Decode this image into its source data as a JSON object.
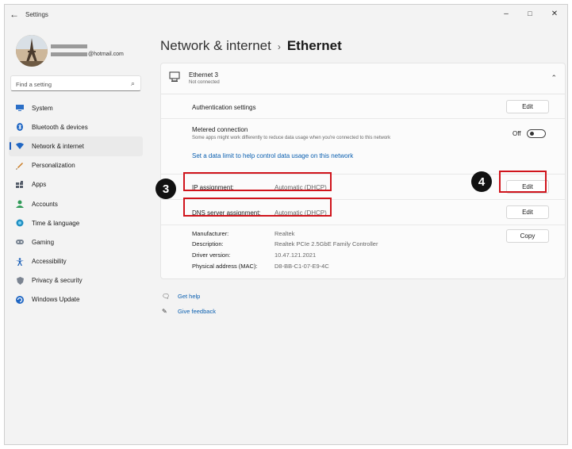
{
  "app": {
    "title": "Settings",
    "window_min": "–",
    "window_max": "□",
    "window_close": "✕"
  },
  "account": {
    "email_suffix": "@hotmail.com"
  },
  "search": {
    "placeholder": "Find a setting"
  },
  "sidebar": {
    "items": [
      {
        "label": "System",
        "icon": "monitor-icon",
        "color": "#2b6fc7"
      },
      {
        "label": "Bluetooth & devices",
        "icon": "bluetooth-icon",
        "color": "#1f66c3"
      },
      {
        "label": "Network & internet",
        "icon": "wifi-icon",
        "color": "#1f66c3",
        "active": true
      },
      {
        "label": "Personalization",
        "icon": "brush-icon",
        "color": "#c9791f"
      },
      {
        "label": "Apps",
        "icon": "apps-icon",
        "color": "#555d6a"
      },
      {
        "label": "Accounts",
        "icon": "person-icon",
        "color": "#2f9a57"
      },
      {
        "label": "Time & language",
        "icon": "globe-clock-icon",
        "color": "#1f8fc2"
      },
      {
        "label": "Gaming",
        "icon": "gamepad-icon",
        "color": "#7a8592"
      },
      {
        "label": "Accessibility",
        "icon": "accessibility-icon",
        "color": "#1a5fb8"
      },
      {
        "label": "Privacy & security",
        "icon": "shield-icon",
        "color": "#7b8491"
      },
      {
        "label": "Windows Update",
        "icon": "refresh-icon",
        "color": "#1f66c3"
      }
    ]
  },
  "header": {
    "breadcrumb_parent": "Network & internet",
    "separator": "›",
    "breadcrumb_current": "Ethernet"
  },
  "adapter": {
    "name": "Ethernet 3",
    "status": "Not connected",
    "auth": {
      "label": "Authentication settings",
      "button": "Edit"
    },
    "metered": {
      "label": "Metered connection",
      "description": "Some apps might work differently to reduce data usage when you're connected to this network",
      "toggle_text": "Off",
      "enabled": false
    },
    "data_limit_link": "Set a data limit to help control data usage on this network",
    "ip": {
      "label": "IP assignment:",
      "value": "Automatic (DHCP)",
      "button": "Edit"
    },
    "dns": {
      "label": "DNS server assignment:",
      "value": "Automatic (DHCP)",
      "button": "Edit"
    },
    "details": {
      "rows": [
        {
          "key": "Manufacturer:",
          "value": "Realtek"
        },
        {
          "key": "Description:",
          "value": "Realtek PCIe 2.5GbE Family Controller"
        },
        {
          "key": "Driver version:",
          "value": "10.47.121.2021"
        },
        {
          "key": "Physical address (MAC):",
          "value": "D8-BB-C1-07-E9-4C"
        }
      ],
      "copy_button": "Copy"
    }
  },
  "help": {
    "get_help": "Get help",
    "give_feedback": "Give feedback"
  },
  "annotations": {
    "step_ip": "3",
    "step_edit": "4",
    "highlight_color": "#d0141c"
  }
}
